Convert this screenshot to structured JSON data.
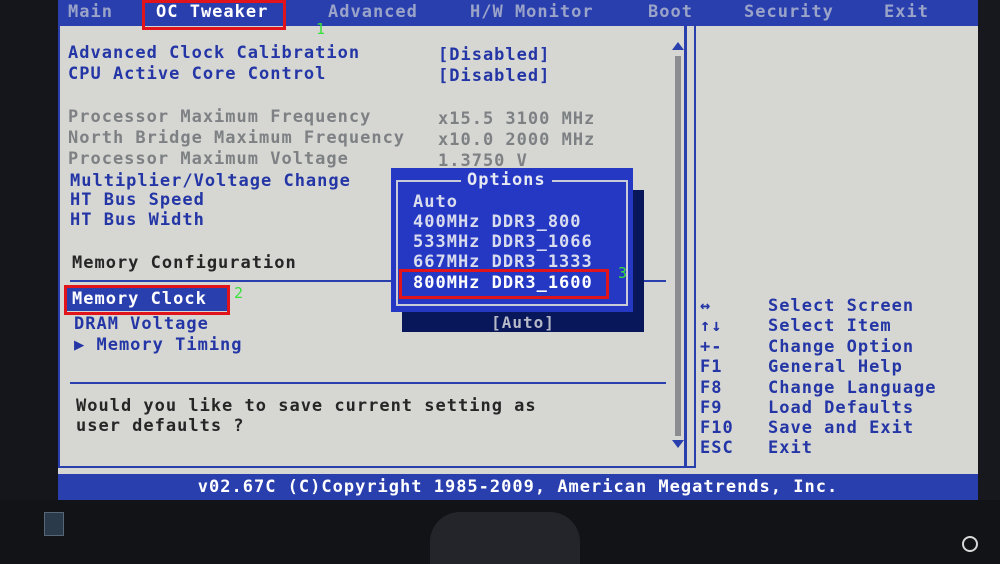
{
  "menu": {
    "tabs": [
      "Main",
      "OC Tweaker",
      "Advanced",
      "H/W Monitor",
      "Boot",
      "Security",
      "Exit"
    ],
    "active_tab": "OC Tweaker"
  },
  "annotations": {
    "marker1": "1",
    "marker2": "2",
    "marker3": "3"
  },
  "settings": {
    "advanced_clock_calibration": {
      "label": "Advanced Clock Calibration",
      "value": "[Disabled]"
    },
    "cpu_active_core_control": {
      "label": "CPU Active Core Control",
      "value": "[Disabled]"
    },
    "processor_max_frequency": {
      "label": "Processor Maximum Frequency",
      "value": "x15.5 3100 MHz"
    },
    "north_bridge_max_frequency": {
      "label": "North Bridge Maximum Frequency",
      "value": "x10.0 2000 MHz"
    },
    "processor_max_voltage": {
      "label": "Processor Maximum Voltage",
      "value": "1.3750 V"
    },
    "multiplier_voltage_change": {
      "label": "Multiplier/Voltage Change"
    },
    "ht_bus_speed": {
      "label": "HT Bus Speed"
    },
    "ht_bus_width": {
      "label": "HT Bus Width"
    },
    "memory_configuration": {
      "label": "Memory Configuration"
    },
    "memory_clock": {
      "label": "Memory Clock"
    },
    "dram_voltage": {
      "label": "DRAM Voltage"
    },
    "memory_timing": {
      "label": "▶ Memory Timing"
    }
  },
  "prompt": {
    "line1": "Would you like to save current setting as",
    "line2": "user defaults ?"
  },
  "popup": {
    "title": "Options",
    "options": [
      "Auto",
      "400MHz DDR3_800",
      "533MHz DDR3_1066",
      "667MHz DDR3_1333",
      "800MHz DDR3_1600"
    ],
    "selected_index": 4,
    "current_value": "[Auto]"
  },
  "help": [
    {
      "key": "↔",
      "desc": "Select Screen"
    },
    {
      "key": "↑↓",
      "desc": "Select Item"
    },
    {
      "key": "+-",
      "desc": "Change Option"
    },
    {
      "key": "F1",
      "desc": "General Help"
    },
    {
      "key": "F8",
      "desc": "Change Language"
    },
    {
      "key": "F9",
      "desc": "Load Defaults"
    },
    {
      "key": "F10",
      "desc": "Save and Exit"
    },
    {
      "key": "ESC",
      "desc": "Exit"
    }
  ],
  "footer": {
    "text": "v02.67C (C)Copyright 1985-2009, American Megatrends, Inc."
  },
  "colors": {
    "bios_blue": "#2a3fae",
    "bios_gray_bg": "#d6d7d3",
    "highlight_red": "#e0141a",
    "marker_green": "#38e03a"
  }
}
